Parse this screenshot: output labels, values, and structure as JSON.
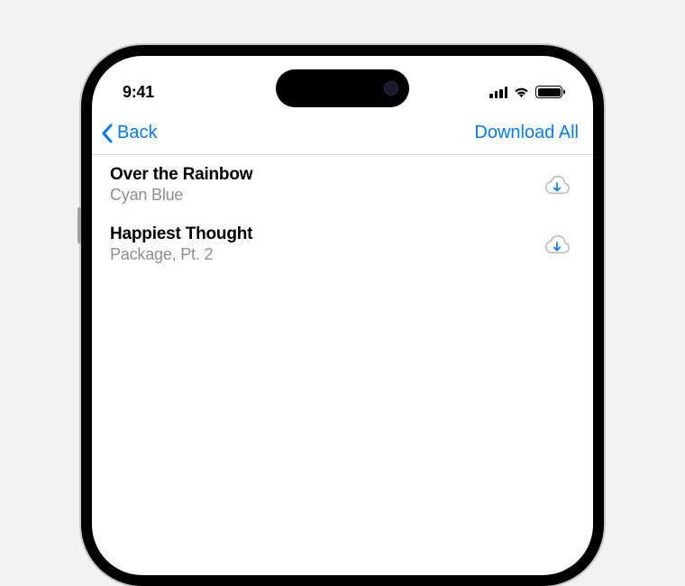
{
  "status_bar": {
    "time": "9:41"
  },
  "nav": {
    "back_label": "Back",
    "download_all_label": "Download All"
  },
  "list": {
    "items": [
      {
        "title": "Over the Rainbow",
        "subtitle": "Cyan Blue"
      },
      {
        "title": "Happiest Thought",
        "subtitle": "Package, Pt. 2"
      }
    ]
  },
  "colors": {
    "accent": "#007aff",
    "secondary_text": "#8e8e93"
  }
}
